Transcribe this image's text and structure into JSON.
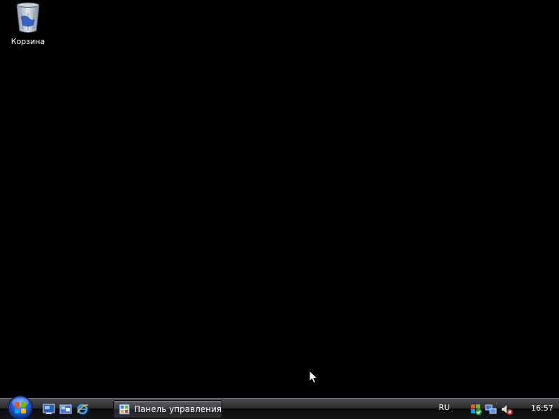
{
  "desktop": {
    "icons": [
      {
        "label": "Корзина",
        "icon": "recycle-bin-icon"
      }
    ]
  },
  "taskbar": {
    "start_icon": "windows-start-orb-icon",
    "quick_launch": [
      {
        "icon": "show-desktop-icon"
      },
      {
        "icon": "switch-windows-icon"
      },
      {
        "icon": "internet-explorer-icon"
      }
    ],
    "open_windows": [
      {
        "label": "Панель управления",
        "icon": "control-panel-icon"
      }
    ],
    "language": "RU",
    "tray_icons": [
      "windows-security-icon",
      "network-icon",
      "volume-muted-icon"
    ],
    "clock": "16:57"
  },
  "colors": {
    "desktop_background": "#000000",
    "accent_blue": "#1a5bd0",
    "taskbar": "#1a1b1e"
  }
}
